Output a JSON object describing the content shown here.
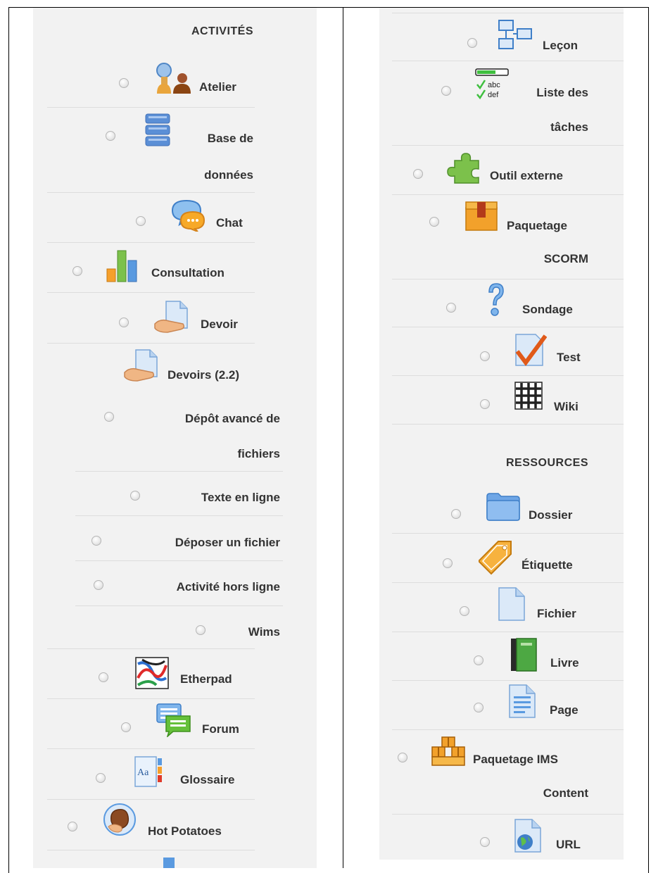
{
  "left_column": {
    "heading": "ACTIVITÉS",
    "items": [
      {
        "icon": "workshop-icon",
        "label": "Atelier"
      },
      {
        "icon": "database-icon",
        "label": "Base de",
        "label2": "données"
      },
      {
        "icon": "chat-icon",
        "label": "Chat"
      },
      {
        "icon": "choice-icon",
        "label": "Consultation"
      },
      {
        "icon": "assignment-icon",
        "label": "Devoir"
      },
      {
        "icon": "assignment-icon",
        "label": "Devoirs (2.2)"
      },
      {
        "label": "Dépôt avancé de",
        "label2": "fichiers"
      },
      {
        "label": "Texte en ligne"
      },
      {
        "label": "Déposer un fichier"
      },
      {
        "label": "Activité hors ligne"
      },
      {
        "label": "Wims"
      },
      {
        "icon": "etherpad-icon",
        "label": "Etherpad"
      },
      {
        "icon": "forum-icon",
        "label": "Forum"
      },
      {
        "icon": "glossary-icon",
        "label": "Glossaire"
      },
      {
        "icon": "hotpot-icon",
        "label": "Hot Potatoes"
      }
    ]
  },
  "right_column": {
    "activities": [
      {
        "icon": "lesson-icon",
        "label": "Leçon"
      },
      {
        "icon": "checklist-icon",
        "label": "Liste des",
        "label2": "tâches"
      },
      {
        "icon": "external-tool-icon",
        "label": "Outil externe"
      },
      {
        "icon": "scorm-icon",
        "label": "Paquetage",
        "label2": "SCORM"
      },
      {
        "icon": "survey-icon",
        "label": "Sondage"
      },
      {
        "icon": "quiz-icon",
        "label": "Test"
      },
      {
        "icon": "wiki-icon",
        "label": "Wiki"
      }
    ],
    "resources_heading": "RESSOURCES",
    "resources": [
      {
        "icon": "folder-icon",
        "label": "Dossier"
      },
      {
        "icon": "label-tag-icon",
        "label": "Étiquette"
      },
      {
        "icon": "file-icon",
        "label": "Fichier"
      },
      {
        "icon": "book-icon",
        "label": "Livre"
      },
      {
        "icon": "page-icon",
        "label": "Page"
      },
      {
        "icon": "ims-package-icon",
        "label": "Paquetage IMS",
        "label2": "Content"
      },
      {
        "icon": "url-icon",
        "label": "URL"
      }
    ]
  },
  "colors": {
    "panel_bg": "#f2f2f2",
    "text": "#333333",
    "separator": "#dddddd"
  }
}
